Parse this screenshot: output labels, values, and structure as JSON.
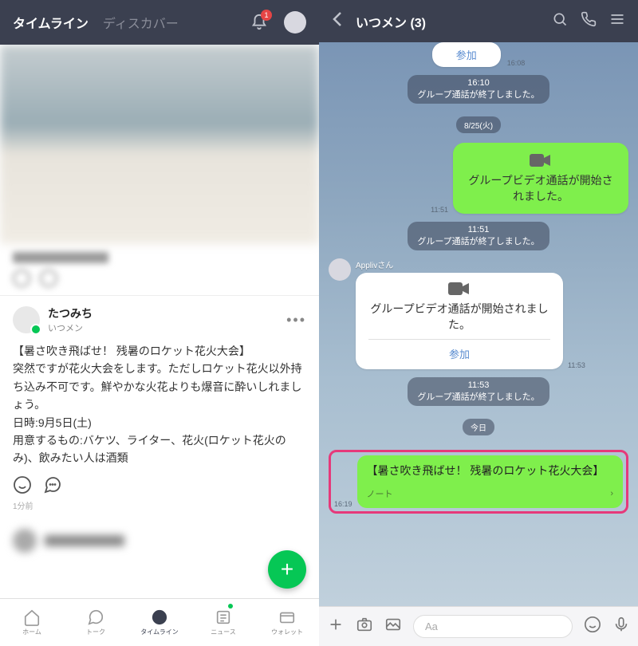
{
  "left": {
    "tabs": {
      "timeline": "タイムライン",
      "discover": "ディスカバー"
    },
    "notification_badge": "1",
    "post": {
      "name": "たつみち",
      "group": "いつメン",
      "content": "【暑さ吹き飛ばせ！ 残暑のロケット花火大会】\n突然ですが花火大会をします。ただしロケット花火以外持ち込み不可です。鮮やかな火花よりも爆音に酔いしれましょう。\n日時:9月5日(土)\n用意するもの:バケツ、ライター、花火(ロケット花火のみ)、飲みたい人は酒類",
      "time": "1分前"
    },
    "tabbar": {
      "home": "ホーム",
      "talk": "トーク",
      "timeline": "タイムライン",
      "news": "ニュース",
      "wallet": "ウォレット"
    }
  },
  "right": {
    "title": "いつメン (3)",
    "msgs": {
      "join1": "参加",
      "time1": "16:08",
      "sys_time1": "16:10",
      "sys1": "グループ通話が終了しました。",
      "date1": "8/25(火)",
      "video_call": "グループビデオ通話が開始されました。",
      "time2": "11:51",
      "sys_time2": "11:51",
      "sys2": "グループ通話が終了しました。",
      "sender": "Applivさん",
      "time3": "11:53",
      "sys_time3": "11:53",
      "sys3": "グループ通話が終了しました。",
      "date2": "今日",
      "note_title": "【暑さ吹き飛ばせ！ 残暑のロケット花火大会】",
      "note_label": "ノート",
      "time4": "16:19"
    },
    "input_placeholder": "Aa"
  }
}
